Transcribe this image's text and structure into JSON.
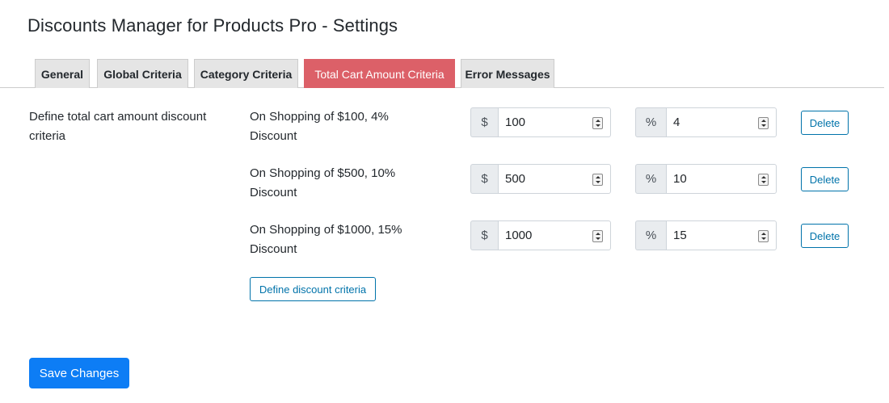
{
  "page": {
    "title": "Discounts Manager for Products Pro - Settings"
  },
  "tabs": [
    {
      "label": "General",
      "active": false
    },
    {
      "label": "Global Criteria",
      "active": false
    },
    {
      "label": "Category Criteria",
      "active": false
    },
    {
      "label": "Total Cart Amount Criteria",
      "active": true
    },
    {
      "label": "Error Messages",
      "active": false
    }
  ],
  "section": {
    "label": "Define total cart amount discount criteria"
  },
  "criteria": [
    {
      "description": "On Shopping of $100, 4% Discount",
      "currency_symbol": "$",
      "amount": "100",
      "percent_symbol": "%",
      "percent": "4",
      "delete_label": "Delete"
    },
    {
      "description": "On Shopping of $500, 10% Discount",
      "currency_symbol": "$",
      "amount": "500",
      "percent_symbol": "%",
      "percent": "10",
      "delete_label": "Delete"
    },
    {
      "description": "On Shopping of $1000, 15% Discount",
      "currency_symbol": "$",
      "amount": "1000",
      "percent_symbol": "%",
      "percent": "15",
      "delete_label": "Delete"
    }
  ],
  "actions": {
    "define_label": "Define discount criteria",
    "save_label": "Save Changes"
  },
  "colors": {
    "active_tab": "#dc6068",
    "primary_button": "#0d7df5",
    "outline_button": "#0073aa"
  }
}
